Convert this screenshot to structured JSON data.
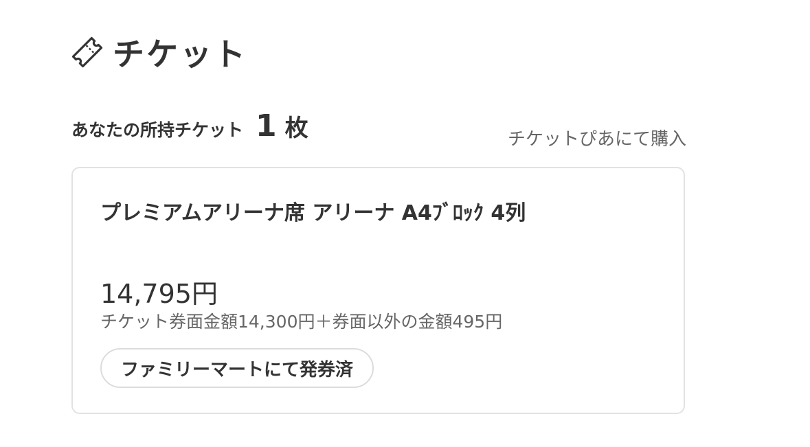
{
  "header": {
    "title": "チケット",
    "icon": "ticket-icon"
  },
  "summary": {
    "owned_label": "あなたの所持チケット",
    "owned_count": "1",
    "owned_unit": "枚",
    "buy_link": "チケットぴあにて購入"
  },
  "ticket": {
    "seat": "プレミアムアリーナ席 アリーナ A4ﾌﾞﾛｯｸ 4列",
    "price": "14,795円",
    "price_breakdown": "チケット券面金額14,300円＋券面以外の金額495円",
    "issue_status": "ファミリーマートにて発券済"
  },
  "colors": {
    "text_primary": "#333333",
    "text_secondary": "#666666",
    "border": "#e2e2e2"
  }
}
